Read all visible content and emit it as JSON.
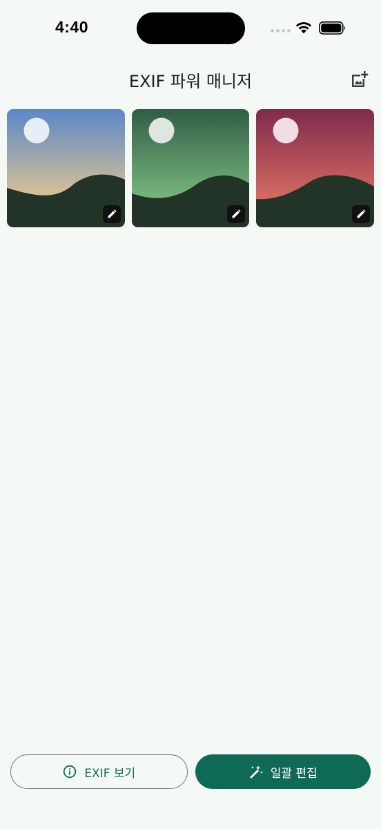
{
  "status_bar": {
    "time": "4:40"
  },
  "app_bar": {
    "title": "EXIF 파워 매니저",
    "add_photo_icon": "add-photo-icon"
  },
  "photos": [
    {
      "label": "photo-1",
      "sky_top": "#5b87c8",
      "sky_bottom": "#d9c294",
      "sun": "#e8eef6",
      "hill": "#223328"
    },
    {
      "label": "photo-2",
      "sky_top": "#2f5e45",
      "sky_bottom": "#78b57d",
      "sun": "#dfe6e1",
      "hill": "#223328"
    },
    {
      "label": "photo-3",
      "sky_top": "#7e2a4d",
      "sky_bottom": "#d46a62",
      "sun": "#f0dde5",
      "hill": "#223328"
    }
  ],
  "actions": {
    "view_exif_label": "EXIF 보기",
    "batch_edit_label": "일괄 편집"
  },
  "colors": {
    "background": "#f4f9f5",
    "accent": "#0f6a55",
    "outline": "#6f7a74"
  }
}
